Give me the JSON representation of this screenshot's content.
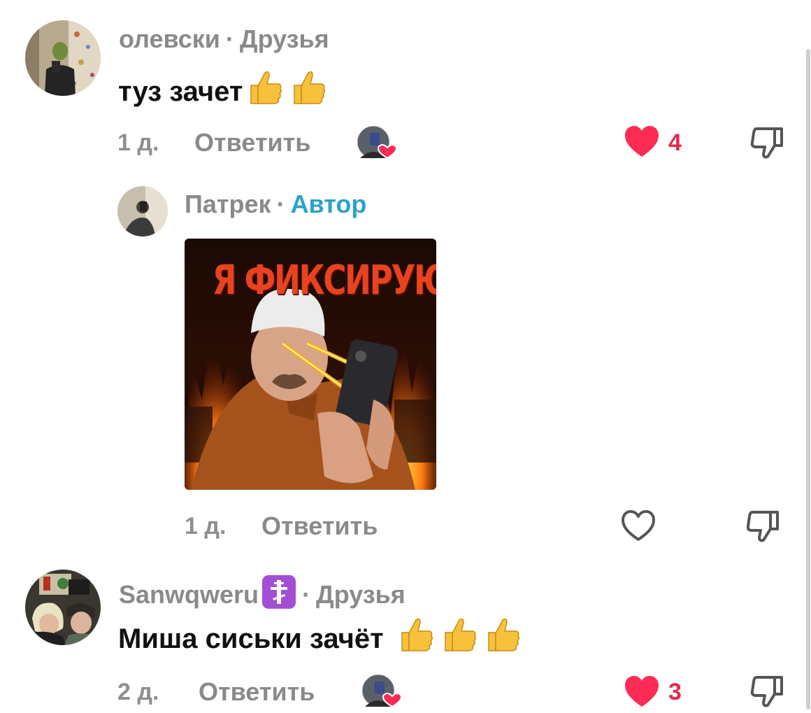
{
  "comments": [
    {
      "username": "олевски",
      "separator": "·",
      "relation": "Друзья",
      "text": "туз зачет",
      "time": "1 д.",
      "reply_label": "Ответить",
      "likes": "4",
      "liked": true
    },
    {
      "username": "Патрек",
      "separator": "·",
      "relation": "Автор",
      "image_title": "Я ФИКСИРУЮ",
      "time": "1 д.",
      "reply_label": "Ответить",
      "liked": false
    },
    {
      "username": "Sanwqweru",
      "separator": "·",
      "relation": "Друзья",
      "text": "Миша сиськи зачёт",
      "time": "2 д.",
      "reply_label": "Ответить",
      "likes": "3",
      "liked": true
    }
  ],
  "colors": {
    "like_red": "#fe2c55",
    "author_blue": "#2aa3c7",
    "meta_gray": "#8a8a8a"
  },
  "icons": [
    "heart-filled-icon",
    "heart-outline-icon",
    "dislike-icon",
    "thumbs-up-emoji",
    "orthodox-cross-emoji"
  ]
}
